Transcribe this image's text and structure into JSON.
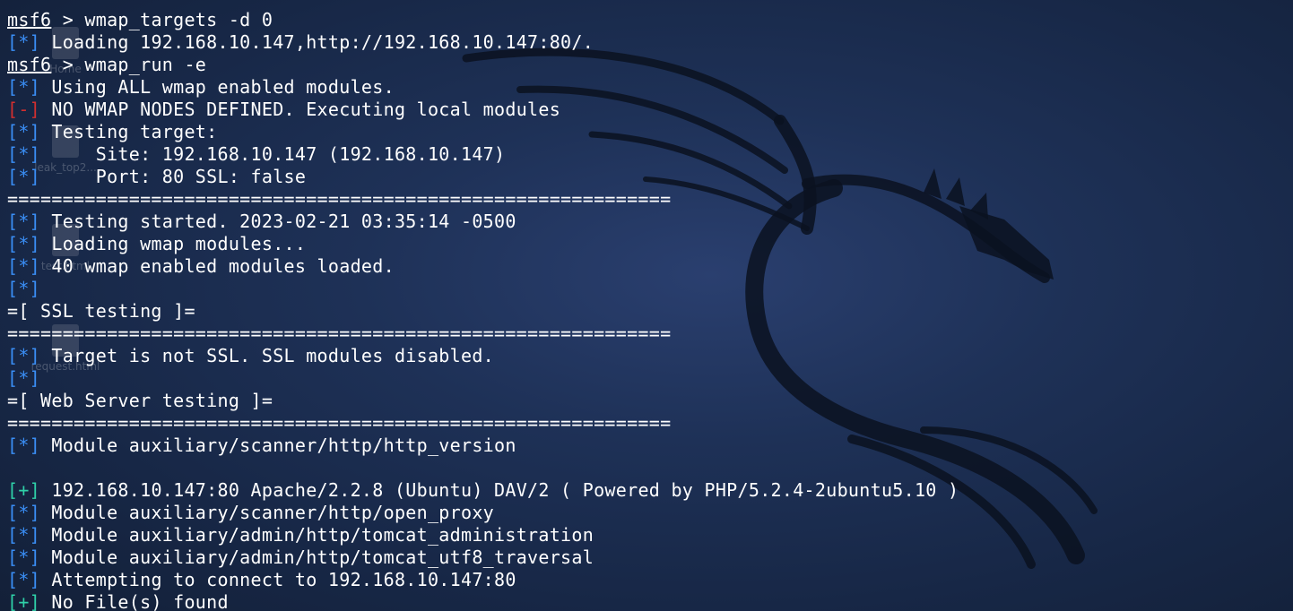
{
  "desktop": {
    "icons": [
      {
        "label": "Home",
        "icon": "home-folder-icon"
      },
      {
        "label": "leak_top2...",
        "icon": "text-file-icon"
      },
      {
        "label": "test.html",
        "icon": "html-file-icon"
      },
      {
        "label": "request.html",
        "icon": "html-file-icon"
      }
    ],
    "wallpaper": "kali-dragon-logo"
  },
  "terminal": {
    "colors": {
      "info": "#3a8ef5",
      "error": "#d22f2f",
      "success": "#2fd0a8",
      "text": "#ffffff"
    },
    "lines": [
      {
        "prompt": "msf6",
        "text": " > wmap_targets -d 0"
      },
      {
        "tag": "[*]",
        "type": "info",
        "text": " Loading 192.168.10.147,http://192.168.10.147:80/."
      },
      {
        "prompt": "msf6",
        "text": " > wmap_run -e"
      },
      {
        "tag": "[*]",
        "type": "info",
        "text": " Using ALL wmap enabled modules."
      },
      {
        "tag": "[-]",
        "type": "err",
        "text": " NO WMAP NODES DEFINED. Executing local modules"
      },
      {
        "tag": "[*]",
        "type": "info",
        "text": " Testing target:"
      },
      {
        "tag": "[*]",
        "type": "info",
        "text": "     Site: 192.168.10.147 (192.168.10.147)"
      },
      {
        "tag": "[*]",
        "type": "info",
        "text": "     Port: 80 SSL: false"
      },
      {
        "text": "============================================================"
      },
      {
        "tag": "[*]",
        "type": "info",
        "text": " Testing started. 2023-02-21 03:35:14 -0500"
      },
      {
        "tag": "[*]",
        "type": "info",
        "text": " Loading wmap modules..."
      },
      {
        "tag": "[*]",
        "type": "info",
        "text": " 40 wmap enabled modules loaded."
      },
      {
        "tag": "[*]",
        "type": "info",
        "text": ""
      },
      {
        "text": "=[ SSL testing ]="
      },
      {
        "text": "============================================================"
      },
      {
        "tag": "[*]",
        "type": "info",
        "text": " Target is not SSL. SSL modules disabled."
      },
      {
        "tag": "[*]",
        "type": "info",
        "text": ""
      },
      {
        "text": "=[ Web Server testing ]="
      },
      {
        "text": "============================================================"
      },
      {
        "tag": "[*]",
        "type": "info",
        "text": " Module auxiliary/scanner/http/http_version"
      },
      {
        "text": ""
      },
      {
        "tag": "[+]",
        "type": "ok",
        "text": " 192.168.10.147:80 Apache/2.2.8 (Ubuntu) DAV/2 ( Powered by PHP/5.2.4-2ubuntu5.10 )"
      },
      {
        "tag": "[*]",
        "type": "info",
        "text": " Module auxiliary/scanner/http/open_proxy"
      },
      {
        "tag": "[*]",
        "type": "info",
        "text": " Module auxiliary/admin/http/tomcat_administration"
      },
      {
        "tag": "[*]",
        "type": "info",
        "text": " Module auxiliary/admin/http/tomcat_utf8_traversal"
      },
      {
        "tag": "[*]",
        "type": "info",
        "text": " Attempting to connect to 192.168.10.147:80"
      },
      {
        "tag": "[+]",
        "type": "ok",
        "text": " No File(s) found"
      }
    ]
  }
}
